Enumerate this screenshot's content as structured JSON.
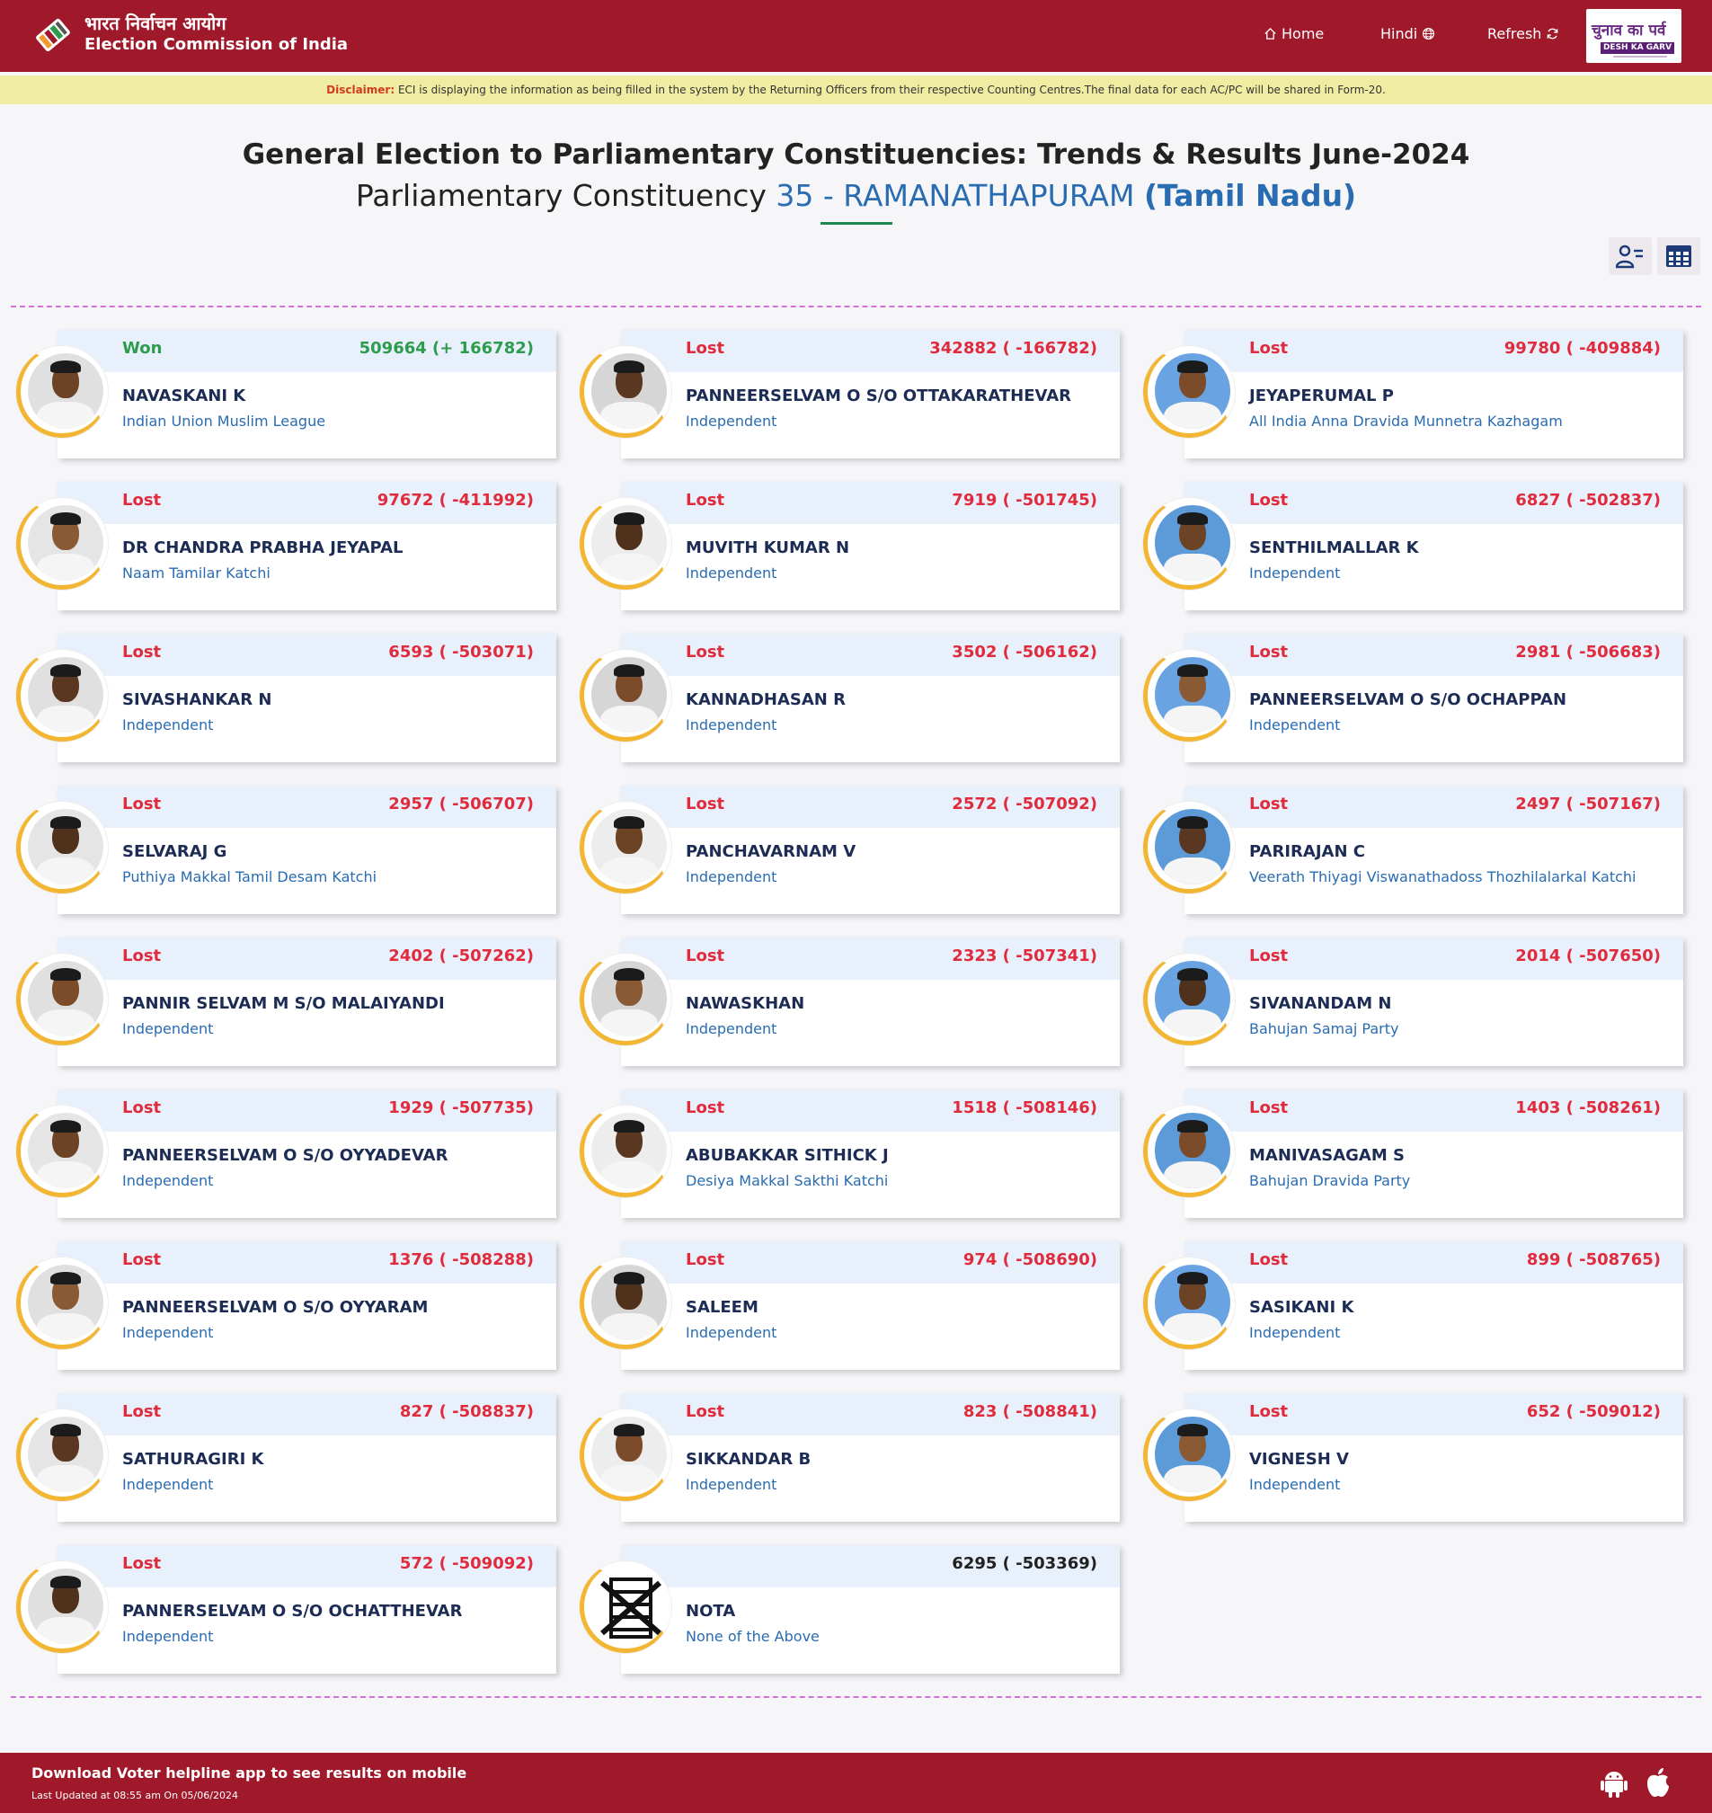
{
  "header": {
    "brand_hi": "भारत निर्वाचन आयोग",
    "brand_en": "Election Commission of India",
    "nav": {
      "home": "Home",
      "hindi": "Hindi",
      "refresh": "Refresh"
    },
    "badge_hi": "चुनाव का पर्व",
    "badge_en": "DESH KA GARV"
  },
  "disclaimer": {
    "label": "Disclaimer:",
    "text": "ECI is displaying the information as being filled in the system by the Returning Officers from their respective Counting Centres.The final data for each AC/PC will be shared in Form-20."
  },
  "page": {
    "title": "General Election to Parliamentary Constituencies: Trends & Results June-2024",
    "subtitle_prefix": "Parliamentary Constituency",
    "constituency": "35 - RAMANATHAPURAM",
    "state": "(Tamil Nadu)"
  },
  "candidates": [
    {
      "status": "Won",
      "votes": "509664 (+ 166782)",
      "name": "NAVASKANI K",
      "party": "Indian Union Muslim League"
    },
    {
      "status": "Lost",
      "votes": "342882 ( -166782)",
      "name": "PANNEERSELVAM O S/O OTTAKARATHEVAR",
      "party": "Independent"
    },
    {
      "status": "Lost",
      "votes": "99780 ( -409884)",
      "name": "JEYAPERUMAL P",
      "party": "All India Anna Dravida Munnetra Kazhagam"
    },
    {
      "status": "Lost",
      "votes": "97672 ( -411992)",
      "name": "DR CHANDRA PRABHA JEYAPAL",
      "party": "Naam Tamilar Katchi"
    },
    {
      "status": "Lost",
      "votes": "7919 ( -501745)",
      "name": "MUVITH KUMAR N",
      "party": "Independent"
    },
    {
      "status": "Lost",
      "votes": "6827 ( -502837)",
      "name": "SENTHILMALLAR K",
      "party": "Independent"
    },
    {
      "status": "Lost",
      "votes": "6593 ( -503071)",
      "name": "SIVASHANKAR N",
      "party": "Independent"
    },
    {
      "status": "Lost",
      "votes": "3502 ( -506162)",
      "name": "KANNADHASAN R",
      "party": "Independent"
    },
    {
      "status": "Lost",
      "votes": "2981 ( -506683)",
      "name": "PANNEERSELVAM O S/O OCHAPPAN",
      "party": "Independent"
    },
    {
      "status": "Lost",
      "votes": "2957 ( -506707)",
      "name": "SELVARAJ G",
      "party": "Puthiya Makkal Tamil Desam Katchi"
    },
    {
      "status": "Lost",
      "votes": "2572 ( -507092)",
      "name": "PANCHAVARNAM V",
      "party": "Independent"
    },
    {
      "status": "Lost",
      "votes": "2497 ( -507167)",
      "name": "PARIRAJAN C",
      "party": "Veerath Thiyagi Viswanathadoss Thozhilalarkal Katchi"
    },
    {
      "status": "Lost",
      "votes": "2402 ( -507262)",
      "name": "PANNIR SELVAM M S/O MALAIYANDI",
      "party": "Independent"
    },
    {
      "status": "Lost",
      "votes": "2323 ( -507341)",
      "name": "NAWASKHAN",
      "party": "Independent"
    },
    {
      "status": "Lost",
      "votes": "2014 ( -507650)",
      "name": "SIVANANDAM N",
      "party": "Bahujan Samaj Party"
    },
    {
      "status": "Lost",
      "votes": "1929 ( -507735)",
      "name": "PANNEERSELVAM O S/O OYYADEVAR",
      "party": "Independent"
    },
    {
      "status": "Lost",
      "votes": "1518 ( -508146)",
      "name": "ABUBAKKAR SITHICK J",
      "party": "Desiya Makkal Sakthi Katchi"
    },
    {
      "status": "Lost",
      "votes": "1403 ( -508261)",
      "name": "MANIVASAGAM S",
      "party": "Bahujan Dravida Party"
    },
    {
      "status": "Lost",
      "votes": "1376 ( -508288)",
      "name": "PANNEERSELVAM O S/O OYYARAM",
      "party": "Independent"
    },
    {
      "status": "Lost",
      "votes": "974 ( -508690)",
      "name": "SALEEM",
      "party": "Independent"
    },
    {
      "status": "Lost",
      "votes": "899 ( -508765)",
      "name": "SASIKANI K",
      "party": "Independent"
    },
    {
      "status": "Lost",
      "votes": "827 ( -508837)",
      "name": "SATHURAGIRI K",
      "party": "Independent"
    },
    {
      "status": "Lost",
      "votes": "823 ( -508841)",
      "name": "SIKKANDAR B",
      "party": "Independent"
    },
    {
      "status": "Lost",
      "votes": "652 ( -509012)",
      "name": "VIGNESH V",
      "party": "Independent"
    },
    {
      "status": "Lost",
      "votes": "572 ( -509092)",
      "name": "PANNERSELVAM O S/O OCHATTHEVAR",
      "party": "Independent"
    },
    {
      "status": "",
      "votes": "6295 ( -503369)",
      "name": "NOTA",
      "party": "None of the Above"
    }
  ],
  "footer": {
    "download": "Download Voter helpline app to see results on mobile",
    "updated": "Last Updated at 08:55 am On 05/06/2024"
  },
  "colors": {
    "header_bg": "#a0192b",
    "won": "#2d9c4d",
    "lost": "#e02b3c",
    "party": "#2a6cb1",
    "card_head": "#e8f0fc"
  }
}
